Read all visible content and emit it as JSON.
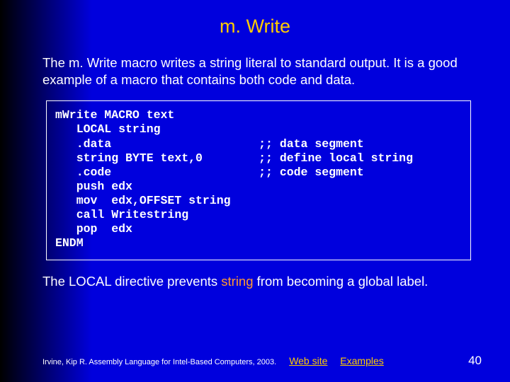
{
  "title": "m. Write",
  "intro": "The m. Write macro writes a string literal to standard output. It is a good example of a macro that contains both code and data.",
  "code": "mWrite MACRO text\n   LOCAL string\n   .data                     ;; data segment\n   string BYTE text,0        ;; define local string\n   .code                     ;; code segment\n   push edx\n   mov  edx,OFFSET string\n   call Writestring\n   pop  edx\nENDM",
  "note_pre": "The LOCAL directive prevents ",
  "note_kw": "string",
  "note_post": " from becoming a global label.",
  "footer": {
    "copyright": "Irvine, Kip R. Assembly Language for Intel-Based Computers, 2003.",
    "link1": "Web site",
    "link2": "Examples"
  },
  "pagenum": "40"
}
